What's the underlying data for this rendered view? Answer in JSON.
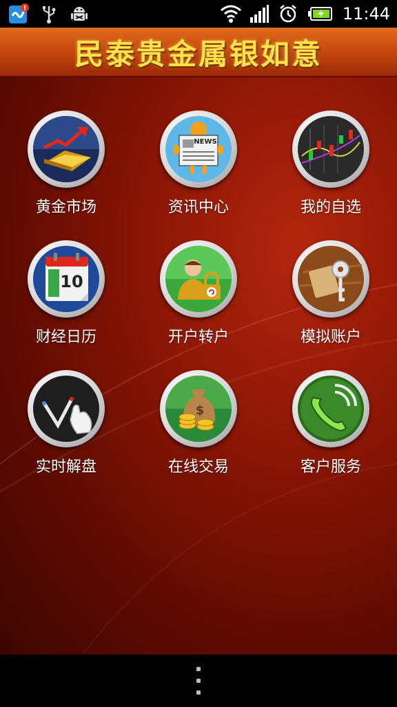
{
  "status_bar": {
    "time": "11:44",
    "icons": [
      "app-notification-icon",
      "usb-icon",
      "android-debug-icon",
      "wifi-icon",
      "signal-icon",
      "alarm-icon",
      "battery-charging-icon"
    ],
    "notification_badge": "!"
  },
  "header": {
    "title": "民泰贵金属银如意"
  },
  "menu": {
    "items": [
      {
        "label": "黄金市场",
        "icon": "gold-market-icon"
      },
      {
        "label": "资讯中心",
        "icon": "news-icon"
      },
      {
        "label": "我的自选",
        "icon": "candlestick-chart-icon"
      },
      {
        "label": "财经日历",
        "icon": "calendar-icon"
      },
      {
        "label": "开户转户",
        "icon": "account-transfer-icon"
      },
      {
        "label": "模拟账户",
        "icon": "key-icon"
      },
      {
        "label": "实时解盘",
        "icon": "touch-chart-icon"
      },
      {
        "label": "在线交易",
        "icon": "money-bag-icon"
      },
      {
        "label": "客户服务",
        "icon": "phone-icon"
      }
    ],
    "calendar_day": "10",
    "news_text": "NEWS"
  },
  "colors": {
    "title_gold": "#ffe24a",
    "background_red": "#8c1606",
    "label_white": "#ffffff"
  }
}
